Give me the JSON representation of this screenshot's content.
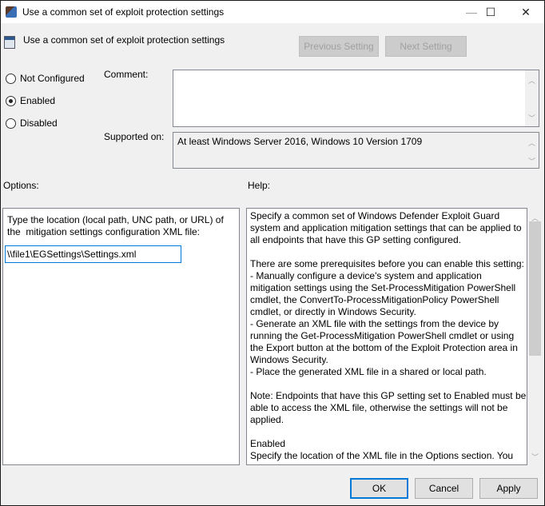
{
  "window": {
    "title": "Use a common set of exploit protection settings",
    "minimize": "—",
    "maximize": "☐",
    "close": "✕"
  },
  "header": {
    "setting_name": "Use a common set of exploit protection settings",
    "previous_label": "Previous Setting",
    "next_label": "Next Setting"
  },
  "state": {
    "options": [
      {
        "label": "Not Configured",
        "selected": false
      },
      {
        "label": "Enabled",
        "selected": true
      },
      {
        "label": "Disabled",
        "selected": false
      }
    ]
  },
  "comment": {
    "label": "Comment:",
    "value": ""
  },
  "supported": {
    "label": "Supported on:",
    "value": "At least Windows Server 2016, Windows 10 Version 1709"
  },
  "options_pane": {
    "label": "Options:",
    "description_line1": "Type the location (local path, UNC path, or URL) of",
    "description_line2": "the  mitigation settings configuration XML file:",
    "path_value": "\\\\file1\\EGSettings\\Settings.xml"
  },
  "help_pane": {
    "label": "Help:",
    "lines": [
      "Specify a common set of Windows Defender Exploit Guard",
      "system and application mitigation settings that can be applied to",
      "all endpoints that have this GP setting configured.",
      "",
      "There are some prerequisites before you can enable this setting:",
      "- Manually configure a device's system and application",
      "mitigation settings using the Set-ProcessMitigation PowerShell",
      "cmdlet, the ConvertTo-ProcessMitigationPolicy PowerShell",
      "cmdlet, or directly in Windows Security.",
      "- Generate an XML file with the settings from the device by",
      "running the Get-ProcessMitigation PowerShell cmdlet or using",
      "the Export button at the bottom of the Exploit Protection area in",
      "Windows Security.",
      "- Place the generated XML file in a shared or local path.",
      "",
      "Note: Endpoints that have this GP setting set to Enabled must be",
      "able to access the XML file, otherwise the settings will not be",
      "applied.",
      "",
      "Enabled",
      "Specify the location of the XML file in the Options section. You"
    ],
    "scroll_fraction": 0.0
  },
  "footer": {
    "ok_label": "OK",
    "cancel_label": "Cancel",
    "apply_label": "Apply"
  },
  "colors": {
    "accent": "#0078d7"
  }
}
